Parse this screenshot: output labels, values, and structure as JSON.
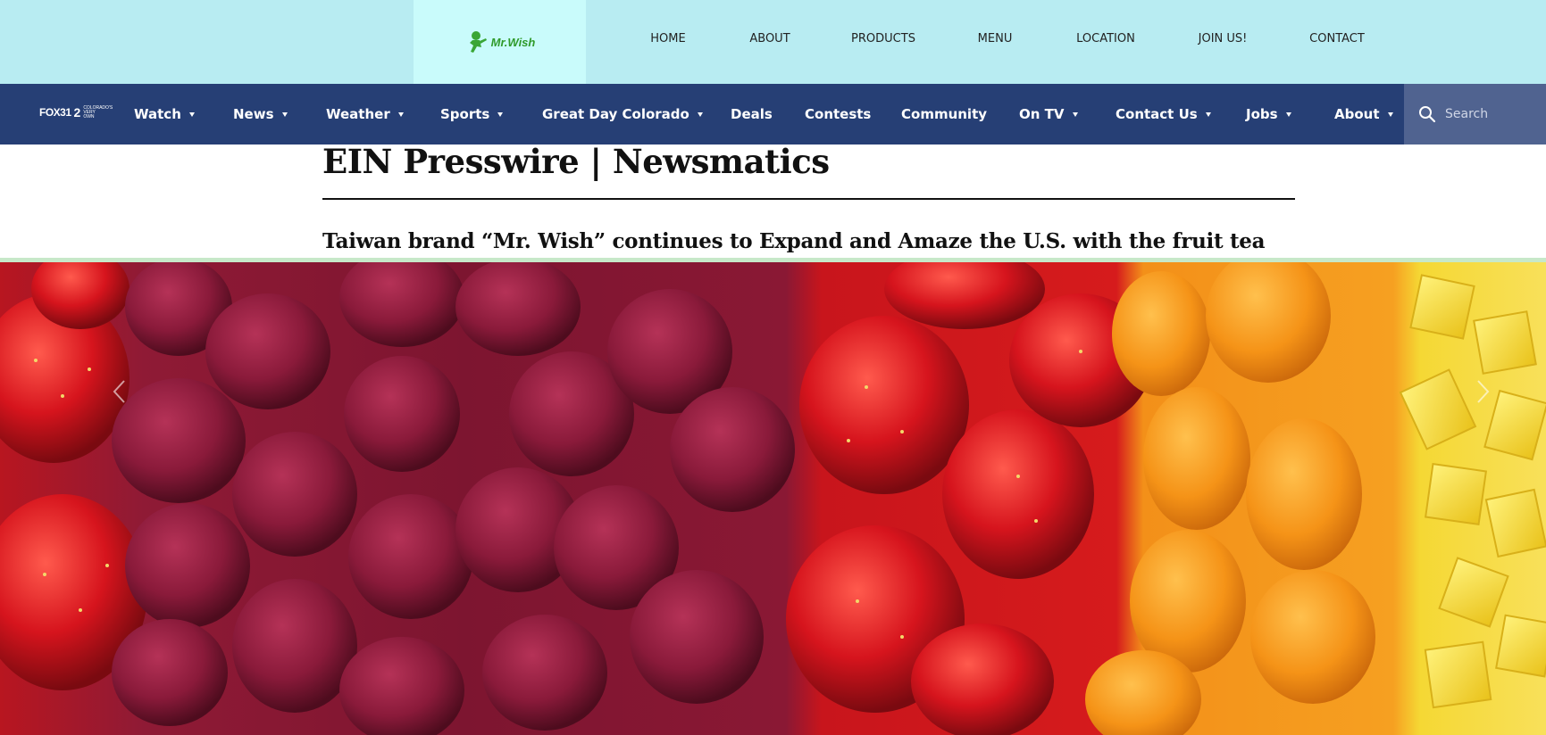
{
  "brand": {
    "logo_text": "Mr.Wish",
    "top_nav": [
      "HOME",
      "ABOUT",
      "PRODUCTS",
      "MENU",
      "LOCATION",
      "JOIN US!",
      "CONTACT"
    ]
  },
  "station": {
    "logo_fox": "FOX31",
    "logo_two": "2",
    "logo_small": "COLORADO'S VERY OWN",
    "nav": [
      {
        "label": "Watch",
        "dropdown": true
      },
      {
        "label": "News",
        "dropdown": true
      },
      {
        "label": "Weather",
        "dropdown": true
      },
      {
        "label": "Sports",
        "dropdown": true
      },
      {
        "label": "Great Day Colorado",
        "dropdown": true
      },
      {
        "label": "Deals",
        "dropdown": false
      },
      {
        "label": "Contests",
        "dropdown": false
      },
      {
        "label": "Community",
        "dropdown": false
      },
      {
        "label": "On TV",
        "dropdown": true
      },
      {
        "label": "Contact Us",
        "dropdown": true
      },
      {
        "label": "Jobs",
        "dropdown": true
      },
      {
        "label": "About",
        "dropdown": true
      }
    ],
    "search_placeholder": "Search"
  },
  "article": {
    "source": "EIN Presswire | Newsmatics",
    "title": "Taiwan brand “Mr. Wish” continues to Expand and Amaze the U.S. with the fruit tea"
  },
  "colors": {
    "topbar": "#b8ecf2",
    "logo_box": "#c9fbfb",
    "station_nav": "#263f75",
    "search_bg": "#506390",
    "logo_green": "#2f9a2a"
  }
}
